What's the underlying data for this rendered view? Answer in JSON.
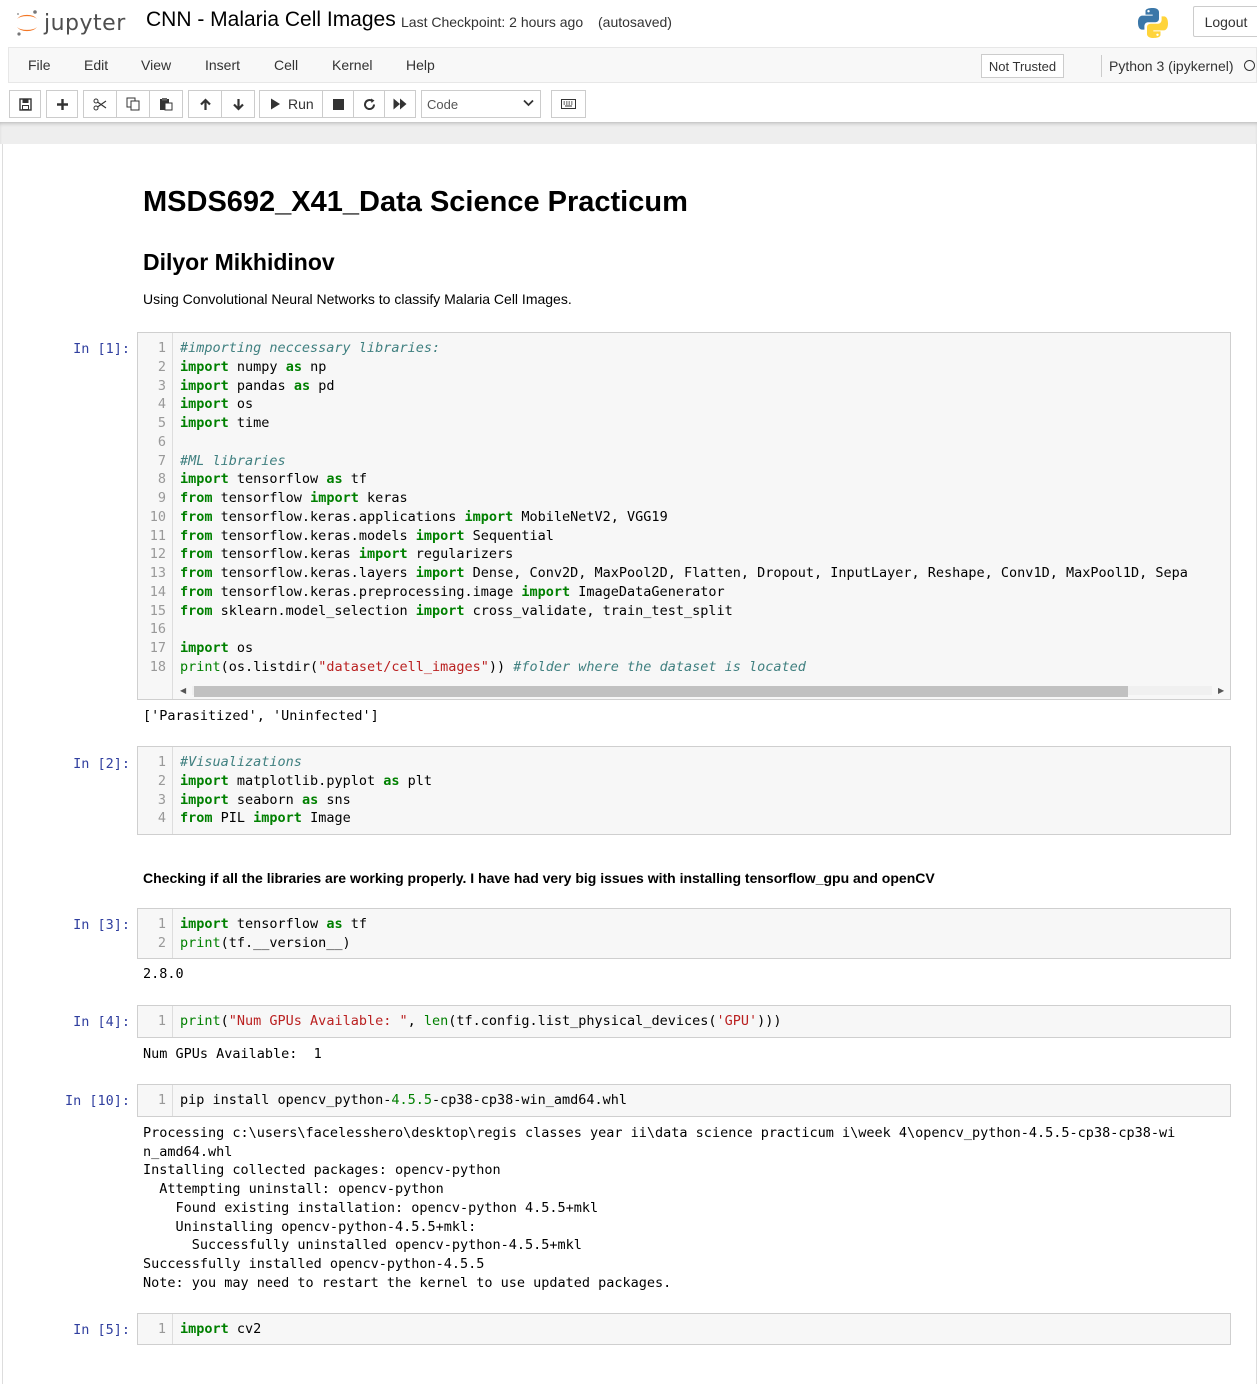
{
  "header": {
    "logo_text": "jupyter",
    "notebook_name": "CNN - Malaria Cell Images",
    "checkpoint": "Last Checkpoint: 2 hours ago",
    "autosave": "(autosaved)",
    "logout_label": "Logout"
  },
  "menu": {
    "items": [
      "File",
      "Edit",
      "View",
      "Insert",
      "Cell",
      "Kernel",
      "Help"
    ],
    "trust_label": "Not Trusted",
    "kernel_name": "Python 3 (ipykernel)"
  },
  "toolbar": {
    "run_label": "Run",
    "cell_type": "Code"
  },
  "markdown": {
    "title": "MSDS692_X41_Data Science Practicum",
    "author": "Dilyor Mikhidinov",
    "intro": "Using Convolutional Neural Networks to classify Malaria Cell Images.",
    "note": "Checking if all the libraries are working properly. I have had very big issues with installing tensorflow_gpu and openCV"
  },
  "cells": [
    {
      "prompt": "In [1]:",
      "lines": [
        "#importing neccessary libraries:",
        "import numpy as np",
        "import pandas as pd",
        "import os",
        "import time",
        "",
        "#ML libraries",
        "import tensorflow as tf",
        "from tensorflow import keras",
        "from tensorflow.keras.applications import MobileNetV2, VGG19",
        "from tensorflow.keras.models import Sequential",
        "from tensorflow.keras import regularizers",
        "from tensorflow.keras.layers import Dense, Conv2D, MaxPool2D, Flatten, Dropout, InputLayer, Reshape, Conv1D, MaxPool1D, Sepa",
        "from tensorflow.keras.preprocessing.image import ImageDataGenerator",
        "from sklearn.model_selection import cross_validate, train_test_split",
        "",
        "import os",
        "print(os.listdir(\"dataset/cell_images\")) #folder where the dataset is located"
      ],
      "output": "['Parasitized', 'Uninfected']"
    },
    {
      "prompt": "In [2]:",
      "lines": [
        "#Visualizations",
        "import matplotlib.pyplot as plt",
        "import seaborn as sns",
        "from PIL import Image"
      ],
      "output": ""
    },
    {
      "prompt": "In [3]:",
      "lines": [
        "import tensorflow as tf",
        "print(tf.__version__)"
      ],
      "output": "2.8.0"
    },
    {
      "prompt": "In [4]:",
      "lines": [
        "print(\"Num GPUs Available: \", len(tf.config.list_physical_devices('GPU')))"
      ],
      "output": "Num GPUs Available:  1"
    },
    {
      "prompt": "In [10]:",
      "lines": [
        "pip install opencv_python-4.5.5-cp38-cp38-win_amd64.whl"
      ],
      "output": "Processing c:\\users\\facelesshero\\desktop\\regis classes year ii\\data science practicum i\\week 4\\opencv_python-4.5.5-cp38-cp38-wi\nn_amd64.whl\nInstalling collected packages: opencv-python\n  Attempting uninstall: opencv-python\n    Found existing installation: opencv-python 4.5.5+mkl\n    Uninstalling opencv-python-4.5.5+mkl:\n      Successfully uninstalled opencv-python-4.5.5+mkl\nSuccessfully installed opencv-python-4.5.5\nNote: you may need to restart the kernel to use updated packages."
    },
    {
      "prompt": "In [5]:",
      "lines": [
        "import cv2"
      ],
      "output": ""
    }
  ],
  "colors": {
    "prompt": "#303f9f",
    "keyword": "#008000",
    "comment": "#408080",
    "string": "#ba2121"
  }
}
